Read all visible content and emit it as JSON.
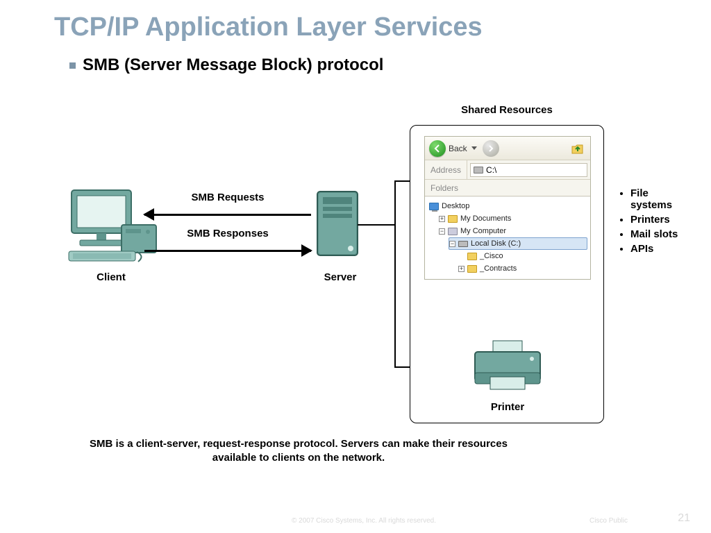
{
  "title": "TCP/IP Application Layer Services",
  "subtitle": "SMB (Server Message Block) protocol",
  "labels": {
    "client": "Client",
    "server": "Server",
    "requests": "SMB Requests",
    "responses": "SMB Responses",
    "shared_resources": "Shared Resources",
    "printer": "Printer"
  },
  "explorer": {
    "back": "Back",
    "address_label": "Address",
    "address_value": "C:\\",
    "folders_header": "Folders",
    "tree": {
      "desktop": "Desktop",
      "my_documents": "My Documents",
      "my_computer": "My Computer",
      "local_disk": "Local Disk (C:)",
      "cisco": "_Cisco",
      "contracts": "_Contracts"
    }
  },
  "resource_list": [
    "File systems",
    "Printers",
    "Mail slots",
    "APIs"
  ],
  "caption": "SMB is a client-server, request-response protocol. Servers can make their resources available to clients on the network.",
  "footer": {
    "copyright": "© 2007 Cisco Systems, Inc. All rights reserved.",
    "label": "Cisco Public",
    "page": "21"
  }
}
